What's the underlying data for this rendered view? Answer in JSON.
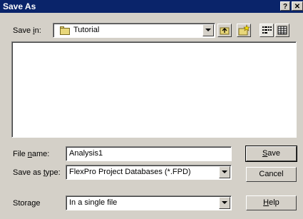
{
  "window": {
    "title": "Save As",
    "help_glyph": "?",
    "close_glyph": "✕"
  },
  "location": {
    "label_pre": "Save ",
    "label_accel": "i",
    "label_post": "n:",
    "folder": "Tutorial"
  },
  "toolbar": {
    "up_one_level": "up-folder-icon",
    "new_folder": "new-folder-icon",
    "list_view": "list-view-icon",
    "details_view": "details-view-icon"
  },
  "file_name": {
    "label_pre": "File ",
    "label_accel": "n",
    "label_post": "ame:",
    "value": "Analysis1"
  },
  "save_as_type": {
    "label_pre": "Save as ",
    "label_accel": "t",
    "label_post": "ype:",
    "value": "FlexPro Project Databases (*.FPD)"
  },
  "storage": {
    "label": "Storage",
    "value": "In a single file"
  },
  "buttons": {
    "save_accel": "S",
    "save_rest": "ave",
    "cancel": "Cancel",
    "help_accel": "H",
    "help_rest": "elp"
  }
}
